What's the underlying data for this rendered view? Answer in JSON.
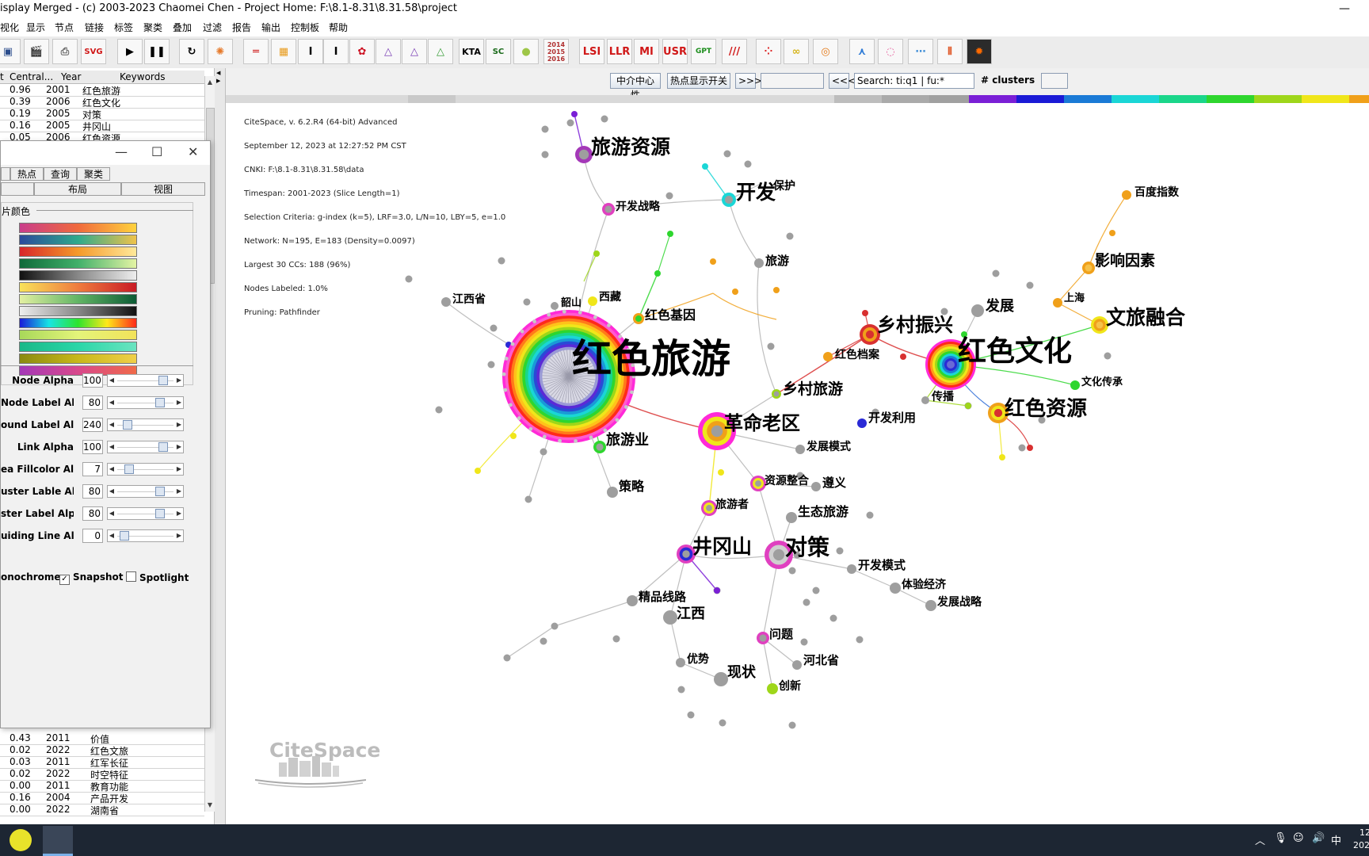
{
  "window": {
    "title": "isplay Merged - (c) 2003-2023 Chaomei Chen - Project Home: F:\\8.1-8.31\\8.31.58\\project"
  },
  "menu": [
    "视化",
    "显示",
    "节点",
    "链接",
    "标签",
    "聚类",
    "叠加",
    "过滤",
    "报告",
    "输出",
    "控制板",
    "帮助"
  ],
  "toolbar": {
    "svg": "SVG",
    "kta": "KTA",
    "sc": "SC",
    "years": [
      "2014",
      "2015",
      "2016"
    ],
    "lsi": "LSI",
    "llr": "LLR",
    "mi": "MI",
    "usr": "USR",
    "gpt": "GPT",
    "slashes": "///"
  },
  "table": {
    "headers": [
      "t",
      "Central...",
      "Year",
      "Keywords"
    ],
    "top_rows": [
      {
        "c": "0.96",
        "y": "2001",
        "k": "红色旅游"
      },
      {
        "c": "0.39",
        "y": "2006",
        "k": "红色文化"
      },
      {
        "c": "0.19",
        "y": "2005",
        "k": "对策"
      },
      {
        "c": "0.16",
        "y": "2005",
        "k": "井冈山"
      },
      {
        "c": "0.05",
        "y": "2006",
        "k": "红色资源"
      }
    ],
    "bottom_rows": [
      {
        "c": "0.43",
        "y": "2011",
        "k": "价值"
      },
      {
        "c": "0.02",
        "y": "2022",
        "k": "红色文旅"
      },
      {
        "c": "0.03",
        "y": "2011",
        "k": "红军长征"
      },
      {
        "c": "0.02",
        "y": "2022",
        "k": "时空特征"
      },
      {
        "c": "0.00",
        "y": "2011",
        "k": "教育功能"
      },
      {
        "c": "0.16",
        "y": "2004",
        "k": "产品开发"
      },
      {
        "c": "0.00",
        "y": "2022",
        "k": "湖南省"
      }
    ]
  },
  "dialog": {
    "tabs_row1": [
      "热点",
      "查询",
      "聚类"
    ],
    "tabs_row2": [
      "布局",
      "视图"
    ],
    "group_title": "片颜色",
    "sliders": [
      {
        "label": "Node Alpha",
        "value": "100",
        "pos": 0.85
      },
      {
        "label": "Node Label Alpha",
        "value": "80",
        "pos": 0.78
      },
      {
        "label": "ound Label Alpha",
        "value": "240",
        "pos": 0.12
      },
      {
        "label": "Link Alpha",
        "value": "100",
        "pos": 0.85
      },
      {
        "label": "ea Fillcolor Alpha",
        "value": "7",
        "pos": 0.15
      },
      {
        "label": "uster Lable Alpha",
        "value": "80",
        "pos": 0.78
      },
      {
        "label": "ster Label Alpha",
        "value": "80",
        "pos": 0.78
      },
      {
        "label": "uiding Line Alpha",
        "value": "0",
        "pos": 0.05
      }
    ],
    "checks": {
      "monochrome": "onochrome",
      "snapshot": "Snapshot",
      "snapshot_check": "✓",
      "spotlight": "Spotlight"
    }
  },
  "canvas_toolbar": {
    "betweenness": "中介中心性",
    "hotspot": "热点显示开关",
    "next": ">>>",
    "prev": "<<<",
    "search_value": "Search: ti:q1 | fu:*",
    "clusters_label": "# clusters"
  },
  "info_lines": [
    "CiteSpace, v. 6.2.R4 (64-bit) Advanced",
    "September 12, 2023 at 12:27:52 PM CST",
    "CNKI: F:\\8.1-8.31\\8.31.58\\data",
    "Timespan: 2001-2023 (Slice Length=1)",
    "Selection Criteria: g-index (k=5), LRF=3.0, L/N=10, LBY=5, e=1.0",
    "Network: N=195, E=183 (Density=0.0097)",
    "Largest 30 CCs: 188 (96%)",
    "Nodes Labeled: 1.0%",
    "Pruning: Pathfinder"
  ],
  "network": {
    "labels": [
      {
        "text": "红色旅游",
        "size": 50
      },
      {
        "text": "红色文化",
        "size": 36
      },
      {
        "text": "旅游资源",
        "size": 25
      },
      {
        "text": "开发",
        "size": 25
      },
      {
        "text": "保护",
        "size": 14
      },
      {
        "text": "开发战略",
        "size": 14
      },
      {
        "text": "旅游",
        "size": 15
      },
      {
        "text": "百度指数",
        "size": 14
      },
      {
        "text": "影响因素",
        "size": 19
      },
      {
        "text": "文旅融合",
        "size": 25
      },
      {
        "text": "上海",
        "size": 13
      },
      {
        "text": "发展",
        "size": 18
      },
      {
        "text": "乡村振兴",
        "size": 24
      },
      {
        "text": "红色档案",
        "size": 14
      },
      {
        "text": "江西省",
        "size": 14
      },
      {
        "text": "韶山",
        "size": 13
      },
      {
        "text": "西藏",
        "size": 14
      },
      {
        "text": "红色基因",
        "size": 16
      },
      {
        "text": "乡村旅游",
        "size": 19
      },
      {
        "text": "传播",
        "size": 14
      },
      {
        "text": "文化传承",
        "size": 13
      },
      {
        "text": "红色资源",
        "size": 26
      },
      {
        "text": "开发利用",
        "size": 15
      },
      {
        "text": "革命老区",
        "size": 24
      },
      {
        "text": "旅游业",
        "size": 18
      },
      {
        "text": "发展模式",
        "size": 14
      },
      {
        "text": "策略",
        "size": 16
      },
      {
        "text": "资源整合",
        "size": 14
      },
      {
        "text": "遵义",
        "size": 15
      },
      {
        "text": "旅游者",
        "size": 14
      },
      {
        "text": "生态旅游",
        "size": 16
      },
      {
        "text": "井冈山",
        "size": 25
      },
      {
        "text": "对策",
        "size": 28
      },
      {
        "text": "开发模式",
        "size": 15
      },
      {
        "text": "体验经济",
        "size": 14
      },
      {
        "text": "发展战略",
        "size": 14
      },
      {
        "text": "精品线路",
        "size": 15
      },
      {
        "text": "江西",
        "size": 18
      },
      {
        "text": "问题",
        "size": 15
      },
      {
        "text": "优势",
        "size": 14
      },
      {
        "text": "河北省",
        "size": 15
      },
      {
        "text": "现状",
        "size": 18
      },
      {
        "text": "创新",
        "size": 14
      }
    ]
  },
  "logo": {
    "text": "CiteSpace"
  },
  "taskbar": {
    "ime": "中",
    "clock1": "12",
    "clock2": "202"
  },
  "colors": {
    "accent": "#4a7ab8",
    "title_bg": "#ffffff",
    "taskbar": "#1d2633"
  }
}
